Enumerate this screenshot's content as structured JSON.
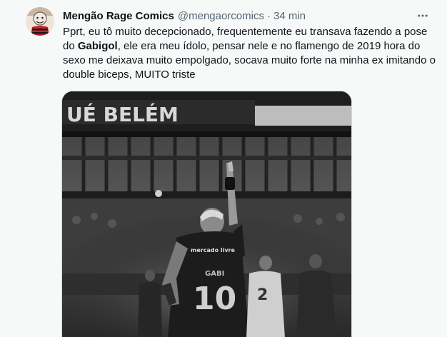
{
  "tweet": {
    "author": {
      "display_name": "Mengão Rage Comics",
      "handle": "@mengaorcomics",
      "separator": "·",
      "time": "34 min"
    },
    "text": {
      "part1": "Pprt, eu tô muito decepcionado, frequentemente eu transava fazendo a pose do ",
      "bold": "Gabigol",
      "part2": ", ele era meu ídolo, pensar nele e no flamengo de 2019 hora do sexo me deixava muito empolgado, socava muito forte na minha ex imitando o double biceps, MUITO triste"
    },
    "photo": {
      "stadium_sign": "UÉ BELÉM",
      "jersey_sponsor": "mercado livre",
      "jersey_name": "GABI",
      "jersey_number": "10",
      "opponent_number": "2"
    },
    "icons": {
      "more": "more-dots-icon",
      "avatar": "avatar-image"
    }
  }
}
